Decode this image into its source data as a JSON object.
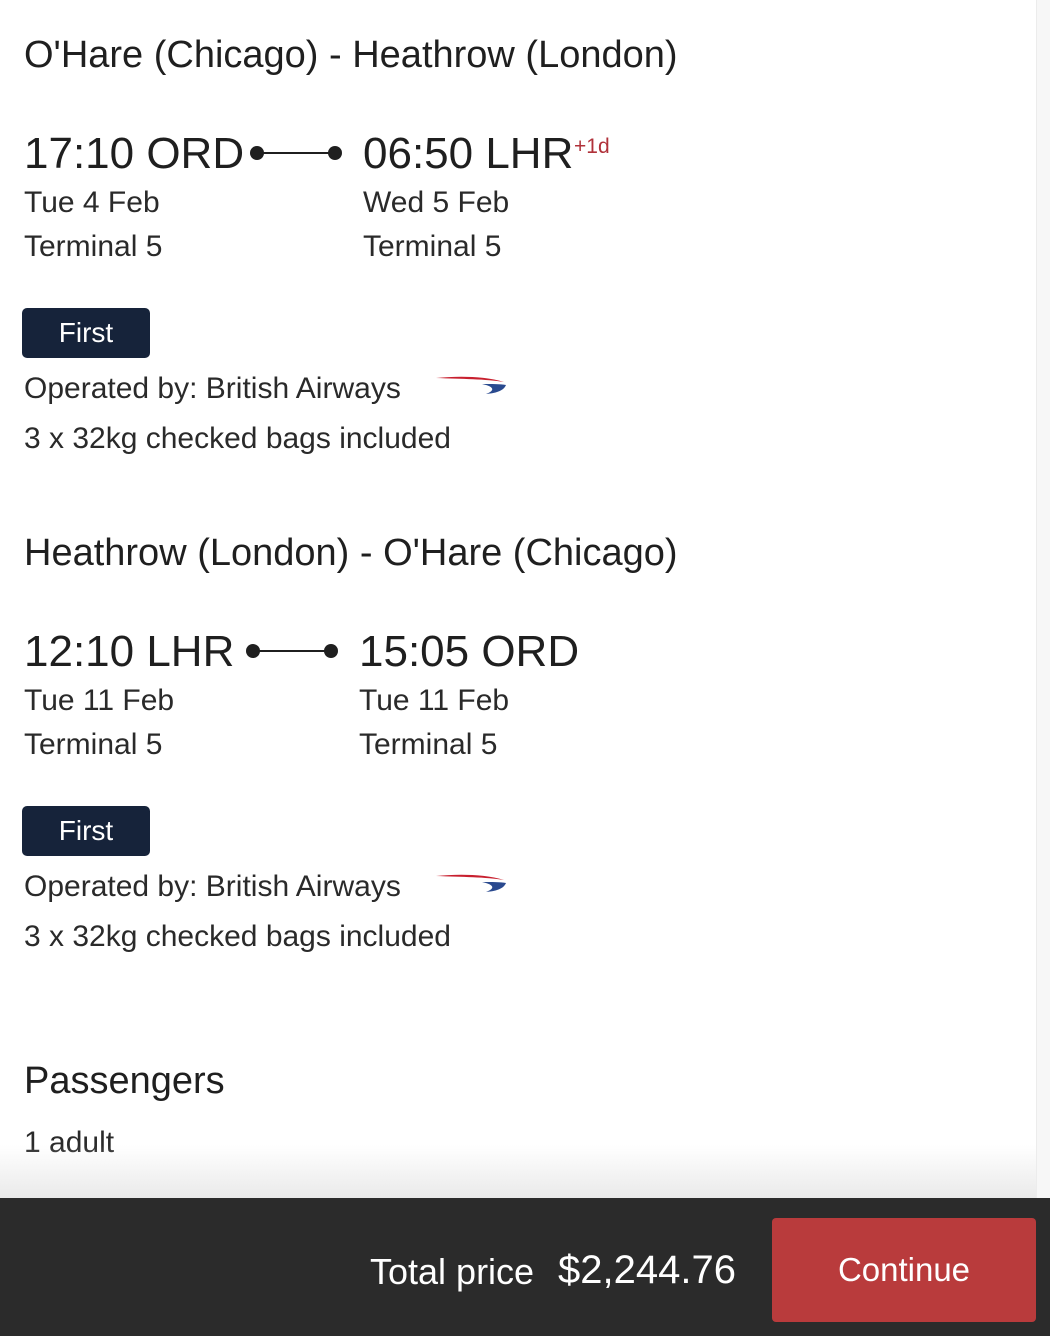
{
  "outbound": {
    "route_title": "O'Hare (Chicago) - Heathrow (London)",
    "departure": {
      "time_airport": "17:10 ORD",
      "date": "Tue 4 Feb",
      "terminal": "Terminal 5"
    },
    "arrival": {
      "time_airport": "06:50 LHR",
      "day_offset": "+1d",
      "date": "Wed 5 Feb",
      "terminal": "Terminal 5"
    },
    "cabin": "First",
    "operated_by": "Operated by: British Airways",
    "airline_logo_icon": "british-airways-speedmarque-icon",
    "baggage": "3 x 32kg checked bags included"
  },
  "inbound": {
    "route_title": "Heathrow (London) - O'Hare (Chicago)",
    "departure": {
      "time_airport": "12:10 LHR",
      "date": "Tue 11 Feb",
      "terminal": "Terminal 5"
    },
    "arrival": {
      "time_airport": "15:05 ORD",
      "date": "Tue 11 Feb",
      "terminal": "Terminal 5"
    },
    "cabin": "First",
    "operated_by": "Operated by: British Airways",
    "airline_logo_icon": "british-airways-speedmarque-icon",
    "baggage": "3 x 32kg checked bags included"
  },
  "passengers": {
    "title": "Passengers",
    "summary": "1 adult"
  },
  "footer": {
    "total_label": "Total price",
    "total_value": "$2,244.76",
    "continue_label": "Continue"
  },
  "colors": {
    "cabin_badge": "#16233a",
    "day_offset": "#b0313a",
    "continue_button": "#b93b3c",
    "footer_bar": "#2b2b2b",
    "logo_red": "#c8202f",
    "logo_blue": "#2a4a8f"
  }
}
